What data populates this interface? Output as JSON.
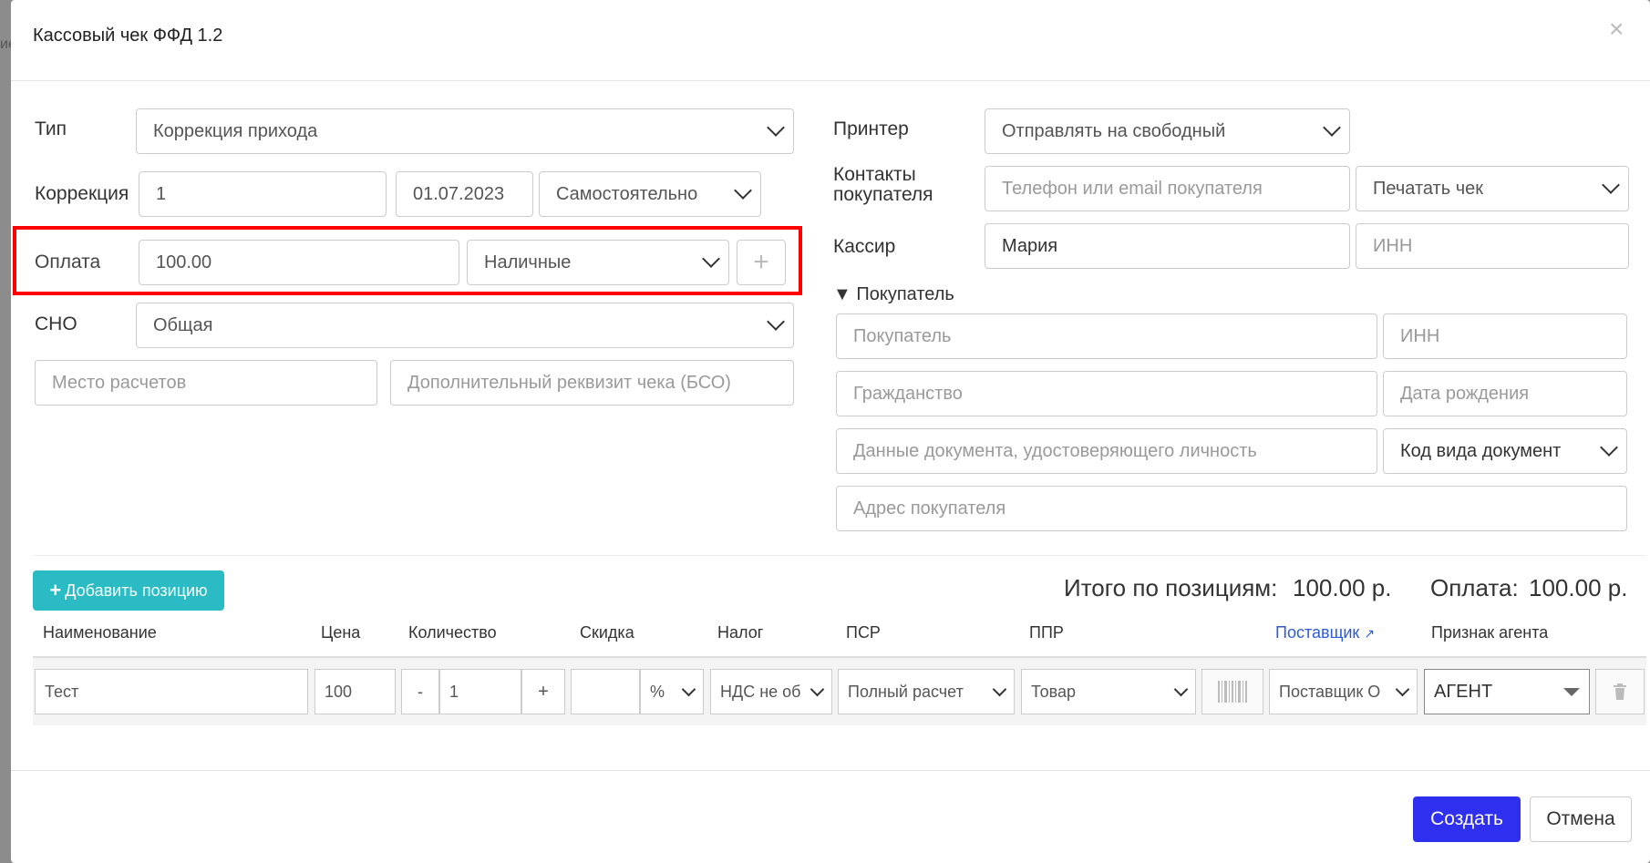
{
  "backdrop": {
    "text": "ие"
  },
  "header": {
    "title": "Кассовый чек ФФД 1.2"
  },
  "left": {
    "type_label": "Тип",
    "type_value": "Коррекция прихода",
    "correction_label": "Коррекция",
    "correction_number": "1",
    "correction_date": "01.07.2023",
    "correction_mode": "Самостоятельно",
    "payment_label": "Оплата",
    "payment_amount": "100.00",
    "payment_method": "Наличные",
    "sno_label": "СНО",
    "sno_value": "Общая",
    "place_placeholder": "Место расчетов",
    "extra_placeholder": "Дополнительный реквизит чека (БСО)"
  },
  "right": {
    "printer_label": "Принтер",
    "printer_value": "Отправлять на свободный",
    "contacts_label_1": "Контакты",
    "contacts_label_2": "покупателя",
    "contacts_placeholder": "Телефон или email покупателя",
    "print_mode": "Печатать чек",
    "cashier_label": "Кассир",
    "cashier_value": "Мария",
    "cashier_inn_placeholder": "ИНН",
    "buyer_toggle": "▼ Покупатель",
    "buyer_placeholder": "Покупатель",
    "buyer_inn_placeholder": "ИНН",
    "citizenship_placeholder": "Гражданство",
    "birth_placeholder": "Дата рождения",
    "doc_placeholder": "Данные документа, удостоверяющего личность",
    "doc_code": "Код вида документ",
    "address_placeholder": "Адрес покупателя"
  },
  "positions": {
    "add_label": "Добавить позицию",
    "total_label": "Итого по позициям:",
    "total_value": "100.00 р.",
    "payment_label": "Оплата:",
    "payment_value": "100.00 р.",
    "columns": {
      "name": "Наименование",
      "price": "Цена",
      "qty": "Количество",
      "discount": "Скидка",
      "tax": "Налог",
      "psr": "ПСР",
      "ppr": "ППР",
      "supplier": "Поставщик",
      "agent": "Признак агента"
    },
    "row": {
      "name": "Тест",
      "price": "100",
      "minus": "-",
      "qty": "1",
      "plus": "+",
      "discount": "",
      "discount_unit": "%",
      "tax": "НДС не об",
      "psr": "Полный расчет",
      "ppr": "Товар",
      "supplier": "Поставщик О",
      "agent": "АГЕНТ"
    }
  },
  "footer": {
    "create_label": "Создать",
    "cancel_label": "Отмена"
  },
  "colors": {
    "accent": "#2f2ff0",
    "teal": "#2bbbc4",
    "highlight": "#ff0000",
    "link": "#2d5bd6"
  }
}
